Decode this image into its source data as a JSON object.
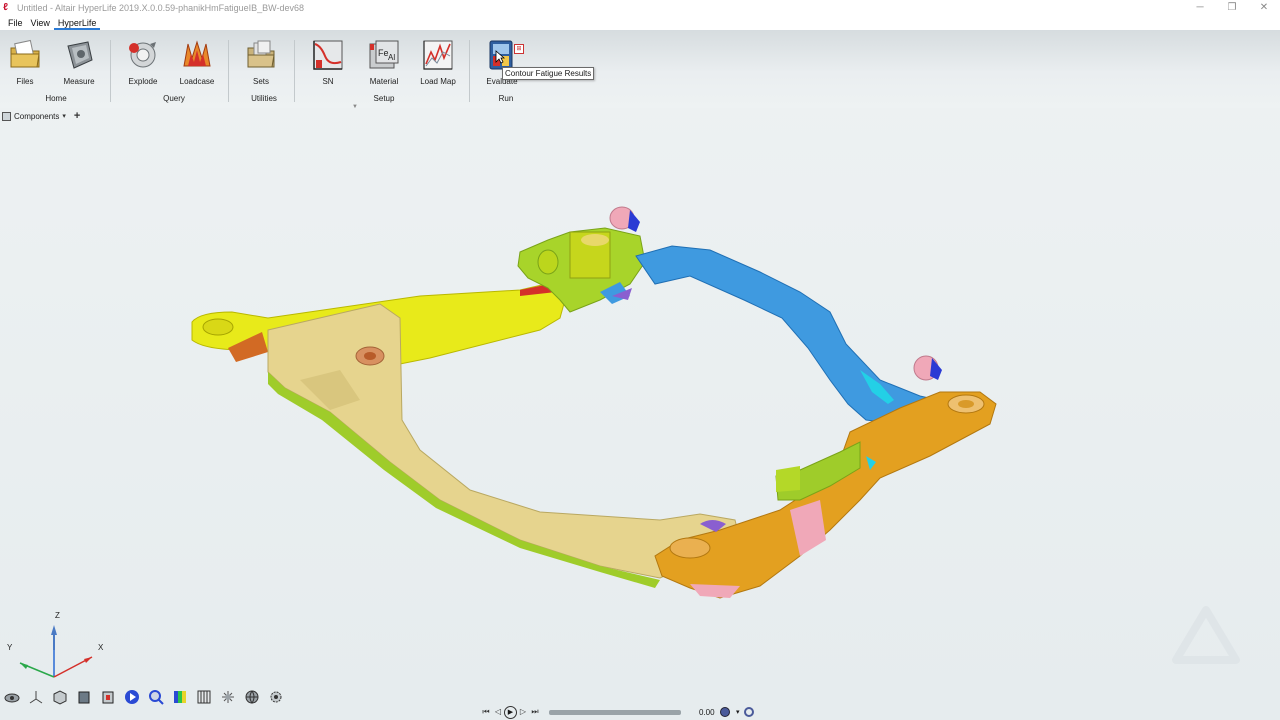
{
  "window": {
    "title": "Untitled - Altair HyperLife 2019.X.0.0.59-phanikHmFatigueIB_BW-dev68",
    "controls": [
      "─",
      "❐",
      "✕"
    ]
  },
  "menu": {
    "items": [
      "File",
      "View",
      "HyperLife"
    ],
    "active": "HyperLife"
  },
  "ribbon": {
    "tools": {
      "files": "Files",
      "measure": "Measure",
      "explode": "Explode",
      "loadcase": "Loadcase",
      "sets": "Sets",
      "sn": "SN",
      "material": "Material",
      "loadmap": "Load Map",
      "evaluate": "Evaluate"
    },
    "groups": {
      "home": "Home",
      "query": "Query",
      "utilities": "Utilities",
      "setup": "Setup",
      "run": "Run"
    },
    "material_icon_text": "Fe Al"
  },
  "tooltip": "Contour Fatigue Results",
  "browser": {
    "label": "Components"
  },
  "triad": {
    "z": "Z",
    "y": "Y",
    "x": "X"
  },
  "animation": {
    "time": "0.00",
    "progress": 0.0
  },
  "colors": {
    "accent": "#2a7ad5",
    "part_yellow": "#e8ea1a",
    "part_tan": "#e6d48e",
    "part_blue": "#3f9ae0",
    "part_orange": "#e3a020",
    "part_lime": "#a8d42a",
    "part_pink": "#f0a8b8"
  },
  "icons": [
    "files-icon",
    "measure-icon",
    "explode-icon",
    "loadcase-icon",
    "sets-icon",
    "sn-curve-icon",
    "material-icon",
    "load-map-icon",
    "evaluate-icon"
  ]
}
